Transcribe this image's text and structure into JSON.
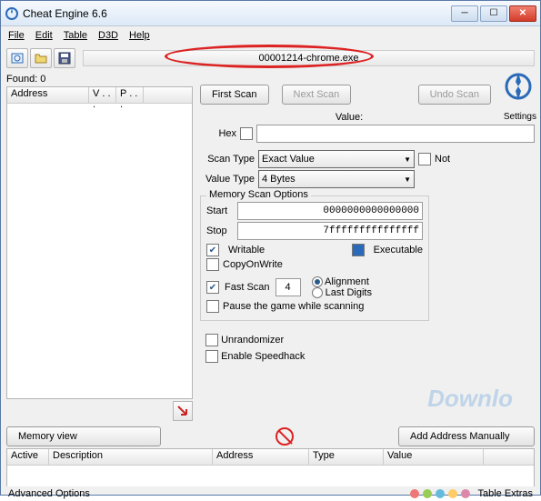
{
  "title": "Cheat Engine 6.6",
  "menu": {
    "file": "File",
    "edit": "Edit",
    "table": "Table",
    "d3d": "D3D",
    "help": "Help"
  },
  "process": "00001214-chrome.exe",
  "found_label": "Found: 0",
  "columns": {
    "address": "Address",
    "v": "V . . .",
    "p": "P . . ."
  },
  "buttons": {
    "first_scan": "First Scan",
    "next_scan": "Next Scan",
    "undo_scan": "Undo Scan",
    "memory_view": "Memory view",
    "add_manual": "Add Address Manually"
  },
  "labels": {
    "value": "Value:",
    "hex": "Hex",
    "scan_type": "Scan Type",
    "value_type": "Value Type",
    "not": "Not",
    "mem_opts": "Memory Scan Options",
    "start": "Start",
    "stop": "Stop",
    "writable": "Writable",
    "executable": "Executable",
    "copyonwrite": "CopyOnWrite",
    "fast_scan": "Fast Scan",
    "alignment": "Alignment",
    "last_digits": "Last Digits",
    "pause": "Pause the game while scanning",
    "unrandomizer": "Unrandomizer",
    "speedhack": "Enable Speedhack",
    "settings": "Settings"
  },
  "values": {
    "scan_type": "Exact Value",
    "value_type": "4 Bytes",
    "start": "0000000000000000",
    "stop": "7fffffffffffffff",
    "fast_scan_val": "4",
    "value_input": ""
  },
  "table_headers": {
    "active": "Active",
    "description": "Description",
    "address": "Address",
    "type": "Type",
    "value": "Value"
  },
  "footer": {
    "advanced": "Advanced Options",
    "extras": "Table Extras"
  },
  "watermark": "Downlo"
}
